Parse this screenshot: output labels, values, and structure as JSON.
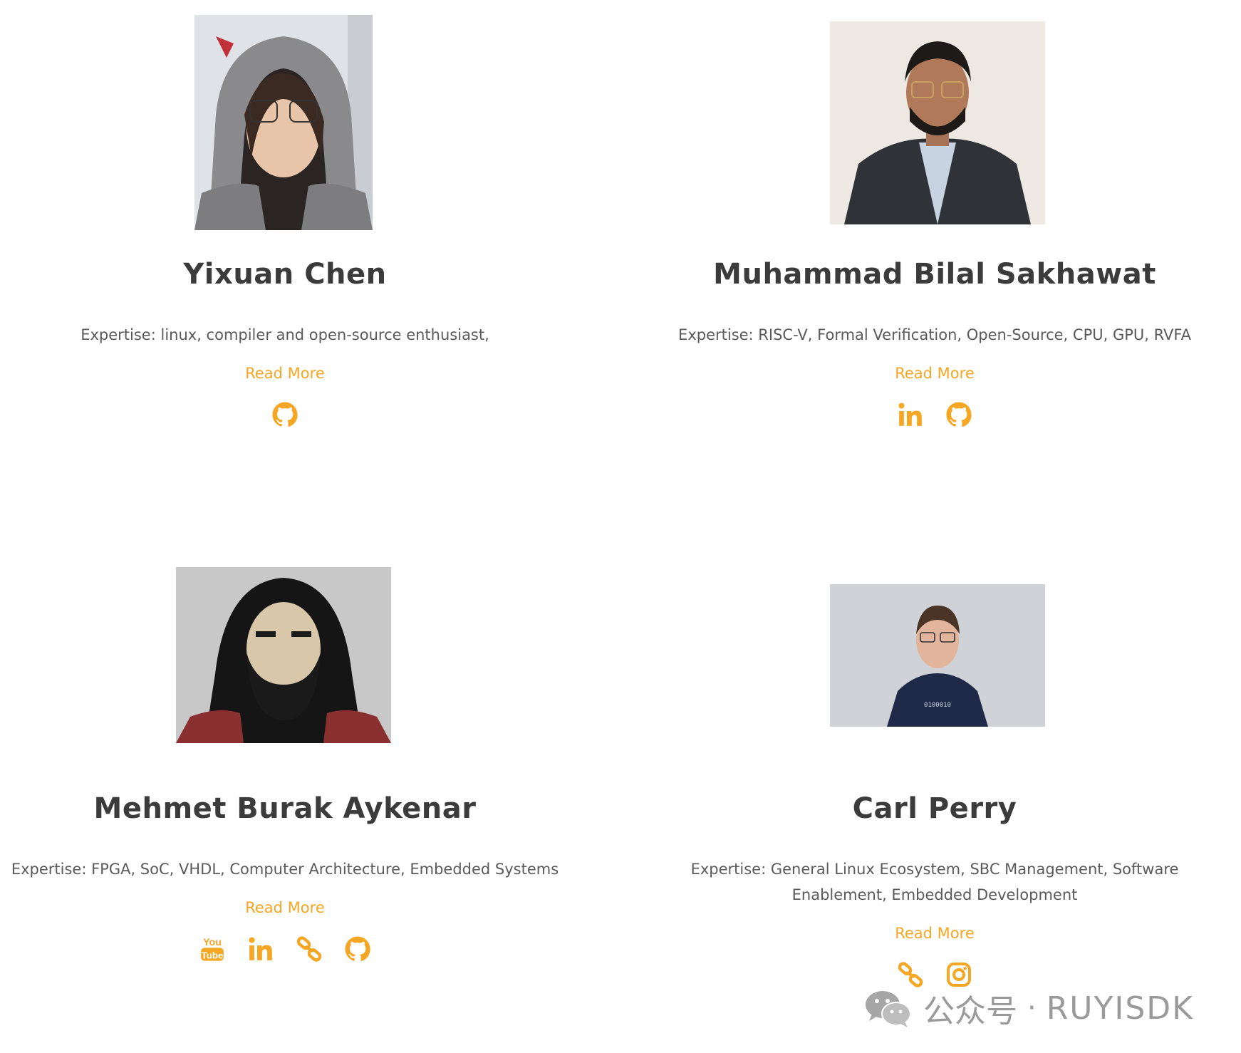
{
  "members": [
    {
      "name": "Yixuan Chen",
      "expertise": "Expertise: linux, compiler and open-source enthusiast,",
      "read_more": "Read More",
      "icons": [
        "github-icon"
      ]
    },
    {
      "name": "Muhammad Bilal Sakhawat",
      "expertise": "Expertise: RISC-V, Formal Verification, Open-Source, CPU, GPU, RVFA",
      "read_more": "Read More",
      "icons": [
        "linkedin-icon",
        "github-icon"
      ]
    },
    {
      "name": "Mehmet Burak Aykenar",
      "expertise": "Expertise: FPGA, SoC, VHDL, Computer Architecture, Embedded Systems",
      "read_more": "Read More",
      "icons": [
        "youtube-icon",
        "linkedin-icon",
        "link-icon",
        "github-icon"
      ]
    },
    {
      "name": "Carl Perry",
      "expertise": "Expertise: General Linux Ecosystem, SBC Management, Software Enablement, Embedded Development",
      "read_more": "Read More",
      "icons": [
        "link-icon",
        "instagram-icon"
      ]
    }
  ],
  "accent_color": "#f5a623",
  "watermark": {
    "label": "公众号",
    "separator": "·",
    "account": "RUYISDK",
    "icon": "wechat-icon"
  }
}
